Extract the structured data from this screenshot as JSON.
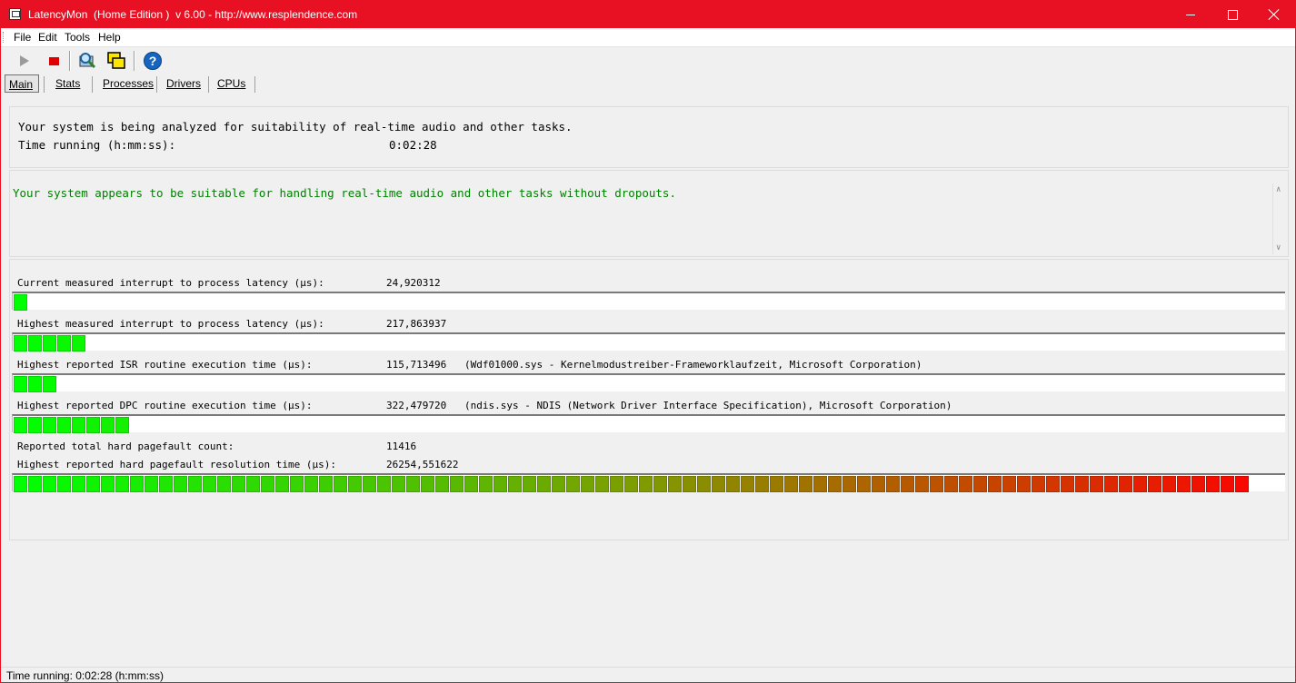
{
  "window": {
    "title": "LatencyMon  (Home Edition )  v 6.00 - http://www.resplendence.com"
  },
  "menu": [
    "File",
    "Edit",
    "Tools",
    "Help"
  ],
  "toolbar": {
    "icons": [
      "play-icon",
      "stop-icon",
      "search-icon",
      "windows-icon",
      "help-icon"
    ]
  },
  "tabs": [
    "Main",
    "Stats",
    "Processes",
    "Drivers",
    "CPUs"
  ],
  "status_panel": {
    "line1": "Your system is being analyzed for suitability of real-time audio and other tasks.",
    "time_label": "Time running (h:mm:ss):",
    "time_value": "0:02:28"
  },
  "verdict": {
    "message": "Your system appears to be suitable for handling real-time audio and other tasks without dropouts.",
    "color": "#008000"
  },
  "metrics": [
    {
      "label": "Current measured interrupt to process latency (µs):",
      "value": "24,920312",
      "extra": "",
      "level_segments": 1
    },
    {
      "label": "Highest measured interrupt to process latency (µs):",
      "value": "217,863937",
      "extra": "",
      "level_segments": 5
    },
    {
      "label": "Highest reported ISR routine execution time (µs):",
      "value": "115,713496",
      "extra": "(Wdf01000.sys - Kernelmodustreiber-Frameworklaufzeit, Microsoft Corporation)",
      "level_segments": 3
    },
    {
      "label": "Highest reported DPC routine execution time (µs):",
      "value": "322,479720",
      "extra": "(ndis.sys - NDIS (Network Driver Interface Specification), Microsoft Corporation)",
      "level_segments": 8
    },
    {
      "label": "Reported total hard pagefault count:",
      "value": "11416",
      "extra": ""
    },
    {
      "label": "Highest reported hard pagefault resolution time (µs):",
      "value": "26254,551622",
      "extra": "",
      "level_segments": 85
    }
  ],
  "status_bar": {
    "text": "Time running: 0:02:28  (h:mm:ss)"
  },
  "colors": {
    "accent": "#e81123",
    "bar_low": "#00ff00",
    "bar_high": "#ff0000"
  }
}
